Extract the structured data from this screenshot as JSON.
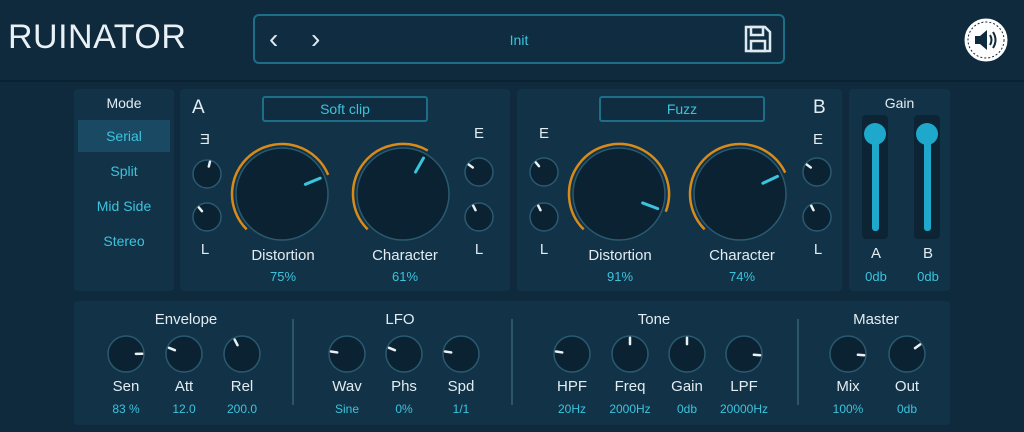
{
  "app": {
    "title": "RUINATOR"
  },
  "preset": {
    "name": "Init",
    "prev_glyph": "‹",
    "next_glyph": "›"
  },
  "icons": {
    "save": "save-icon",
    "logo": "speaker-logo-icon",
    "prev": "chevron-left-icon",
    "next": "chevron-right-icon"
  },
  "colors": {
    "accent": "#3cc3dc",
    "arc": "#d98b1a",
    "panel": "#123347",
    "background": "#0f2a3d"
  },
  "mode": {
    "label": "Mode",
    "options": [
      "Serial",
      "Split",
      "Mid Side",
      "Stereo"
    ],
    "selected": "Serial"
  },
  "channel_a": {
    "label": "A",
    "type": "Soft clip",
    "small_top": "E",
    "small_bottom": "L",
    "small_right_top": "E",
    "small_right_bottom": "L",
    "distortion": {
      "label": "Distortion",
      "value": "75%",
      "level": 0.75
    },
    "character": {
      "label": "Character",
      "value": "61%",
      "level": 0.61
    }
  },
  "channel_b": {
    "label": "B",
    "type": "Fuzz",
    "small_top": "E",
    "small_bottom": "L",
    "small_right_top": "E",
    "small_right_bottom": "L",
    "distortion": {
      "label": "Distortion",
      "value": "91%",
      "level": 0.91
    },
    "character": {
      "label": "Character",
      "value": "74%",
      "level": 0.74
    }
  },
  "gain": {
    "label": "Gain",
    "a": {
      "label": "A",
      "value": "0db",
      "level": 0.95
    },
    "b": {
      "label": "B",
      "value": "0db",
      "level": 0.95
    }
  },
  "envelope": {
    "label": "Envelope",
    "knobs": [
      {
        "label": "Sen",
        "value": "83 %",
        "level": 0.83
      },
      {
        "label": "Att",
        "value": "12.0",
        "level": 0.25
      },
      {
        "label": "Rel",
        "value": "200.0",
        "level": 0.4
      }
    ]
  },
  "lfo": {
    "label": "LFO",
    "knobs": [
      {
        "label": "Wav",
        "value": "Sine",
        "level": 0.2
      },
      {
        "label": "Phs",
        "value": "0%",
        "level": 0.25
      },
      {
        "label": "Spd",
        "value": "1/1",
        "level": 0.2
      }
    ]
  },
  "tone": {
    "label": "Tone",
    "knobs": [
      {
        "label": "HPF",
        "value": "20Hz",
        "level": 0.2
      },
      {
        "label": "Freq",
        "value": "2000Hz",
        "level": 0.5
      },
      {
        "label": "Gain",
        "value": "0db",
        "level": 0.5
      },
      {
        "label": "LPF",
        "value": "20000Hz",
        "level": 0.85
      }
    ]
  },
  "master": {
    "label": "Master",
    "knobs": [
      {
        "label": "Mix",
        "value": "100%",
        "level": 0.85
      },
      {
        "label": "Out",
        "value": "0db",
        "level": 0.7
      }
    ]
  }
}
